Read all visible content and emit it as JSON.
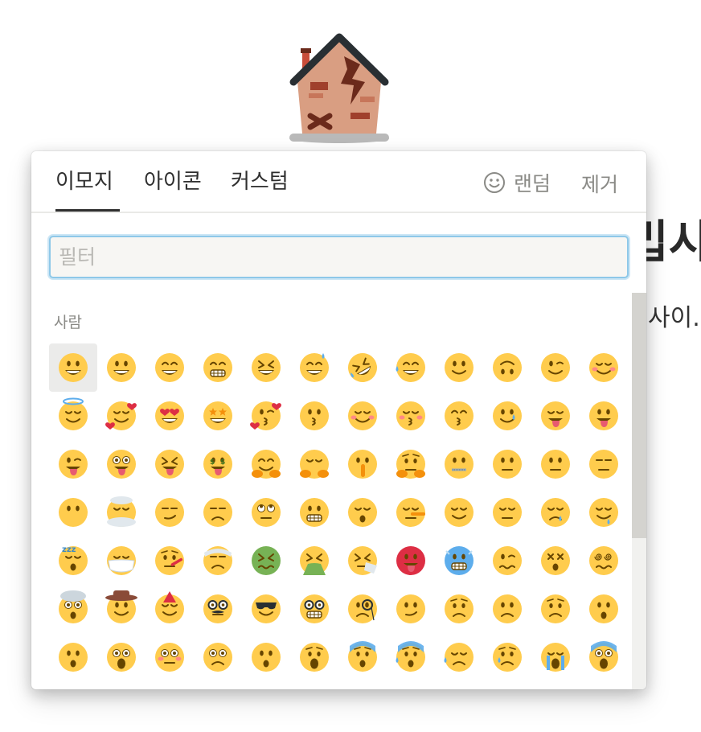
{
  "page": {
    "icon_name": "derelict-house-icon",
    "title_peek": "밉시",
    "body_peek": "사이."
  },
  "picker": {
    "tabs": [
      {
        "label": "이모지",
        "active": true
      },
      {
        "label": "아이콘",
        "active": false
      },
      {
        "label": "커스텀",
        "active": false
      }
    ],
    "random_label": "랜덤",
    "random_icon": "smiley-outline-icon",
    "remove_label": "제거",
    "filter_placeholder": "필터",
    "filter_value": "",
    "section_label": "사람",
    "accent_color": "#8ec8e8",
    "emoji_face_color": "#ffcc4d",
    "emoji_rows": [
      [
        "grinning",
        "smiley",
        "smile",
        "grin",
        "laughing",
        "sweat-smile",
        "rofl",
        "joy",
        "slightly-smiling",
        "upside-down",
        "wink",
        "blush"
      ],
      [
        "innocent",
        "smiling-hearts",
        "heart-eyes",
        "star-struck",
        "kissing-heart",
        "kissing",
        "relaxed",
        "kissing-closed-eyes",
        "kissing-smiling-eyes",
        "tear-smile",
        "yum",
        "tongue"
      ],
      [
        "winking-tongue",
        "zany",
        "squinting-tongue",
        "money-mouth",
        "hugging",
        "hand-over-mouth",
        "shushing",
        "thinking",
        "zipper-mouth",
        "raised-eyebrow",
        "neutral",
        "expressionless"
      ],
      [
        "no-mouth",
        "face-in-clouds",
        "smirk",
        "unamused",
        "rolling-eyes",
        "grimacing",
        "exhaling",
        "lying",
        "relieved",
        "pensive",
        "sleepy",
        "drooling"
      ],
      [
        "sleeping",
        "mask",
        "thermometer",
        "head-bandage",
        "nauseated",
        "vomiting",
        "sneezing",
        "hot",
        "cold",
        "woozy",
        "dizzy",
        "spiral-eyes"
      ],
      [
        "exploding-head",
        "cowboy",
        "partying",
        "disguised",
        "sunglasses",
        "nerd",
        "monocle",
        "confused",
        "worried",
        "slightly-frowning",
        "frowning",
        "open-mouth"
      ],
      [
        "hushed",
        "astonished",
        "flushed",
        "pleading",
        "frowning-open",
        "anguished",
        "fearful",
        "cold-sweat",
        "disappointed-relieved",
        "cry",
        "sob",
        "scream"
      ]
    ]
  }
}
